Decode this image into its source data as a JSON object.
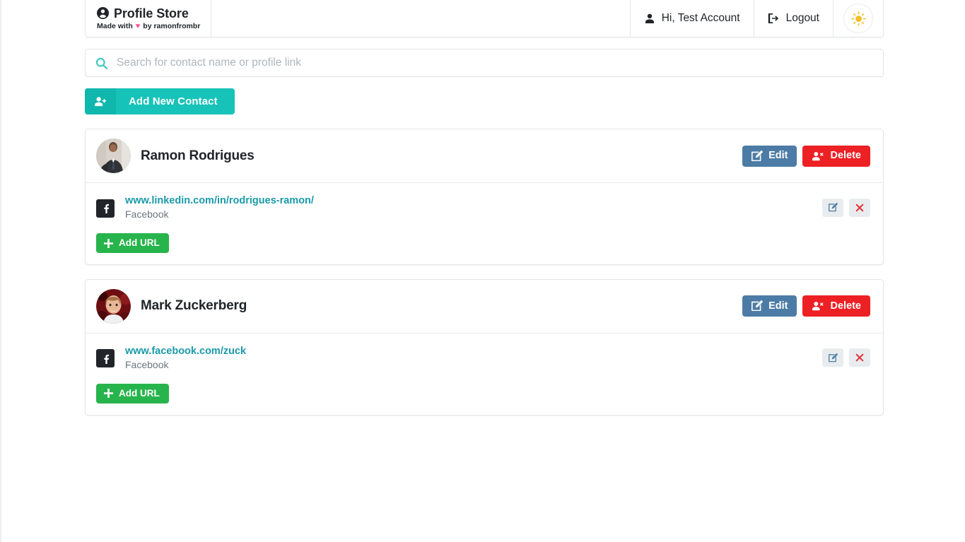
{
  "navbar": {
    "brand_title": "Profile Store",
    "brand_made_with": "Made with",
    "brand_heart": "♥",
    "brand_by": "by ramonfrombr",
    "greeting": "Hi, Test Account",
    "logout": "Logout",
    "theme_toggle_icon": "sun-icon"
  },
  "search": {
    "placeholder": "Search for contact name or profile link",
    "value": "",
    "icon": "search-icon"
  },
  "toolbar": {
    "add_contact_label": "Add New Contact",
    "add_contact_icon": "user-plus-icon"
  },
  "labels": {
    "edit": "Edit",
    "delete": "Delete",
    "add_url": "Add URL",
    "edit_icon": "pencil-square-icon",
    "delete_icon": "user-times-icon",
    "remove_icon": "times-icon",
    "plus_icon": "plus-icon"
  },
  "colors": {
    "teal": "#17c3b8",
    "link": "#1b9aaa",
    "edit_blue": "#4c7ca5",
    "delete_red": "#ed2024",
    "green": "#28b44c",
    "sun_yellow": "#f5bd27"
  },
  "contacts": [
    {
      "name": "Ramon Rodrigues",
      "avatar": "photo-man-in-suit",
      "urls": [
        {
          "link": "www.linkedin.com/in/rodrigues-ramon/",
          "type": "Facebook",
          "icon": "facebook-icon"
        }
      ]
    },
    {
      "name": "Mark Zuckerberg",
      "avatar": "photo-man-red-background",
      "urls": [
        {
          "link": "www.facebook.com/zuck",
          "type": "Facebook",
          "icon": "facebook-icon"
        }
      ]
    }
  ]
}
